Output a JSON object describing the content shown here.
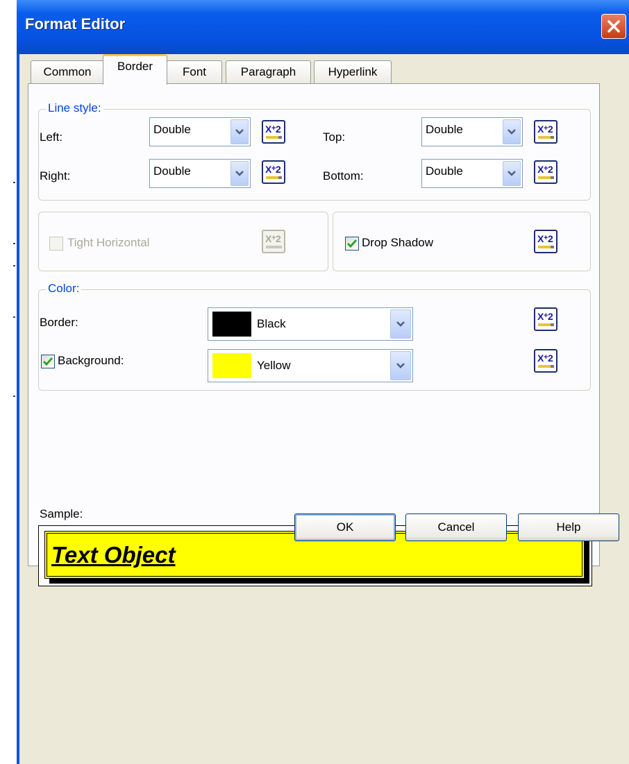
{
  "window": {
    "title": "Format Editor"
  },
  "tabs": [
    {
      "label": "Common"
    },
    {
      "label": "Border"
    },
    {
      "label": "Font"
    },
    {
      "label": "Paragraph"
    },
    {
      "label": "Hyperlink"
    }
  ],
  "active_tab": "Border",
  "line_style": {
    "legend": "Line style:",
    "left": {
      "label": "Left:",
      "value": "Double"
    },
    "top": {
      "label": "Top:",
      "value": "Double"
    },
    "right": {
      "label": "Right:",
      "value": "Double"
    },
    "bottom": {
      "label": "Bottom:",
      "value": "Double"
    }
  },
  "options": {
    "tight_horizontal": {
      "label": "Tight Horizontal",
      "checked": false,
      "enabled": false
    },
    "drop_shadow": {
      "label": "Drop Shadow",
      "checked": true,
      "enabled": true
    }
  },
  "color": {
    "legend": "Color:",
    "border": {
      "label": "Border:",
      "value": "Black",
      "swatch": "#000000"
    },
    "background": {
      "label": "Background:",
      "checked": true,
      "value": "Yellow",
      "swatch": "#FFFF00"
    }
  },
  "sample": {
    "label": "Sample:",
    "text": "Text Object"
  },
  "buttons": {
    "ok": "OK",
    "cancel": "Cancel",
    "help": "Help"
  },
  "icons": {
    "formula": "formula-x2-icon",
    "dropdown": "chevron-down-icon",
    "check": "checkmark-icon",
    "close": "close-icon"
  },
  "colors": {
    "titlebar": "#0553E0",
    "dialog_bg": "#ECE9D8",
    "legend_text": "#0046D5",
    "check_green": "#21A121"
  }
}
